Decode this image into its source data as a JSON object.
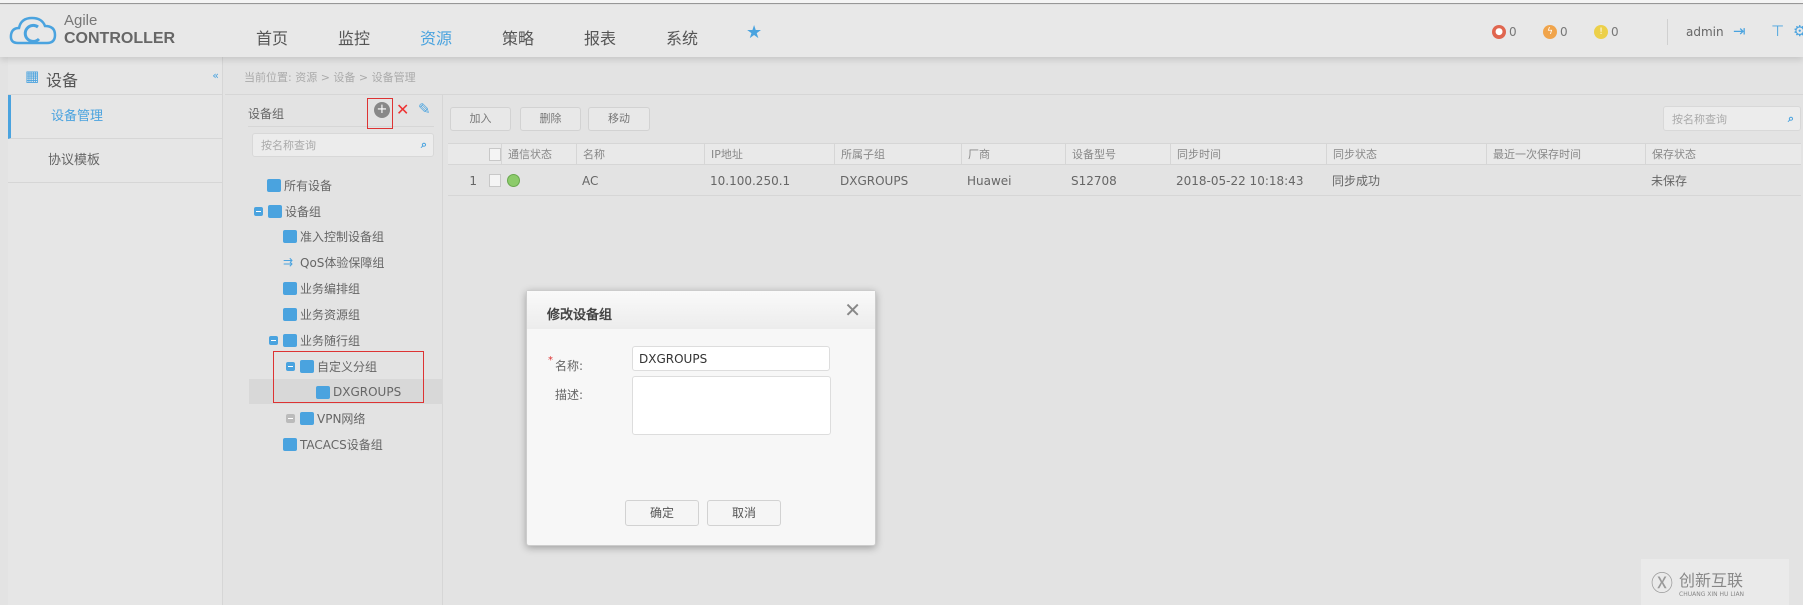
{
  "header": {
    "logo_line1": "Agile",
    "logo_line2": "CONTROLLER",
    "nav": [
      {
        "label": "首页"
      },
      {
        "label": "监控"
      },
      {
        "label": "资源",
        "active": true
      },
      {
        "label": "策略"
      },
      {
        "label": "报表"
      },
      {
        "label": "系统"
      }
    ],
    "favorites_icon": "star-icon",
    "alarms": [
      {
        "icon": "critical-alarm-icon",
        "count": "0",
        "color": "#e0664f"
      },
      {
        "icon": "major-alarm-icon",
        "count": "0",
        "color": "#f0a44b"
      },
      {
        "icon": "warning-alarm-icon",
        "count": "0",
        "color": "#ecd04a"
      }
    ],
    "user": "admin",
    "accent": "#4aa3df"
  },
  "sidebar": {
    "title": "设备",
    "items": [
      {
        "label": "设备管理",
        "active": true
      },
      {
        "label": "协议模板"
      }
    ]
  },
  "breadcrumb": "当前位置: 资源 > 设备 > 设备管理",
  "tree": {
    "title": "设备组",
    "search_placeholder": "按名称查询",
    "nodes": [
      {
        "label": "所有设备"
      },
      {
        "label": "设备组",
        "expanded": true
      },
      {
        "label": "准入控制设备组"
      },
      {
        "label": "QoS体验保障组"
      },
      {
        "label": "业务编排组"
      },
      {
        "label": "业务资源组"
      },
      {
        "label": "业务随行组",
        "expanded": true
      },
      {
        "label": "自定义分组",
        "expanded": true
      },
      {
        "label": "DXGROUPS",
        "selected": true
      },
      {
        "label": "VPN网络",
        "expanded": false
      },
      {
        "label": "TACACS设备组"
      }
    ]
  },
  "toolbar": {
    "add": "加入",
    "delete": "删除",
    "move": "移动",
    "search_placeholder": "按名称查询"
  },
  "table": {
    "columns": [
      "通信状态",
      "名称",
      "IP地址",
      "所属子组",
      "厂商",
      "设备型号",
      "同步时间",
      "同步状态",
      "最近一次保存时间",
      "保存状态"
    ],
    "rows": [
      {
        "index": "1",
        "status": "online",
        "name": "AC",
        "ip": "10.100.250.1",
        "group": "DXGROUPS",
        "vendor": "Huawei",
        "model": "S12708",
        "sync_time": "2018-05-22 10:18:43",
        "sync_status": "同步成功",
        "last_save": "",
        "save_status": "未保存"
      }
    ]
  },
  "dialog": {
    "title": "修改设备组",
    "name_label": "名称:",
    "name_value": "DXGROUPS",
    "desc_label": "描述:",
    "desc_value": "",
    "ok": "确定",
    "cancel": "取消"
  },
  "watermark": {
    "text": "创新互联",
    "sub": "CHUANG XIN HU LIAN"
  }
}
